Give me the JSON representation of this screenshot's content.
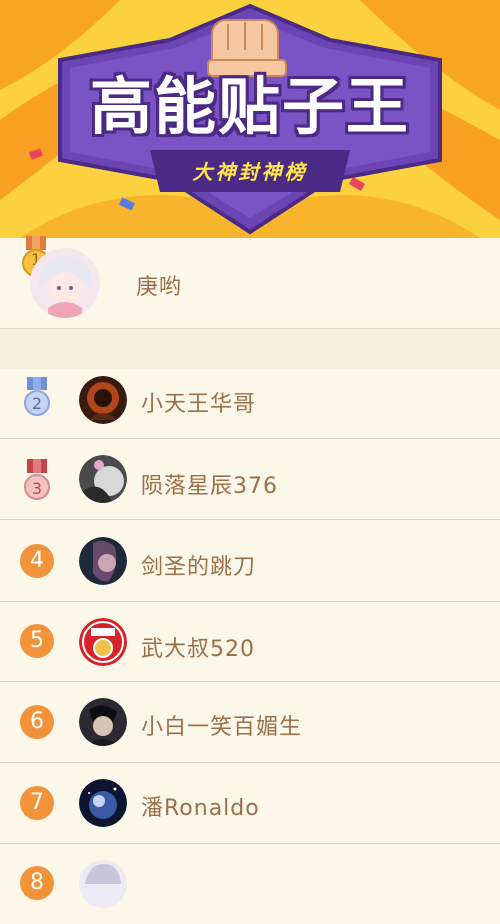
{
  "banner": {
    "title": "高能贴子王",
    "subtitle": "大神封神榜"
  },
  "ranking": [
    {
      "rank": "1",
      "name": "庚哟",
      "badge": "gold-medal"
    },
    {
      "rank": "2",
      "name": "小天王华哥",
      "badge": "silver-medal"
    },
    {
      "rank": "3",
      "name": "陨落星辰376",
      "badge": "bronze-medal"
    },
    {
      "rank": "4",
      "name": "剑圣的跳刀",
      "badge": "orange-circle"
    },
    {
      "rank": "5",
      "name": "武大叔520",
      "badge": "orange-circle"
    },
    {
      "rank": "6",
      "name": "小白一笑百媚生",
      "badge": "orange-circle"
    },
    {
      "rank": "7",
      "name": "潘Ronaldo",
      "badge": "orange-circle"
    },
    {
      "rank": "8",
      "name": "",
      "badge": "orange-circle"
    }
  ],
  "colors": {
    "banner_bg": "#fbd13e",
    "plaque": "#6a45b3",
    "name_text": "#9a6f4a",
    "rank_circle": "#f2933a",
    "gold": "#f5c242",
    "silver": "#9db3e6",
    "bronze": "#e8a0a0"
  }
}
